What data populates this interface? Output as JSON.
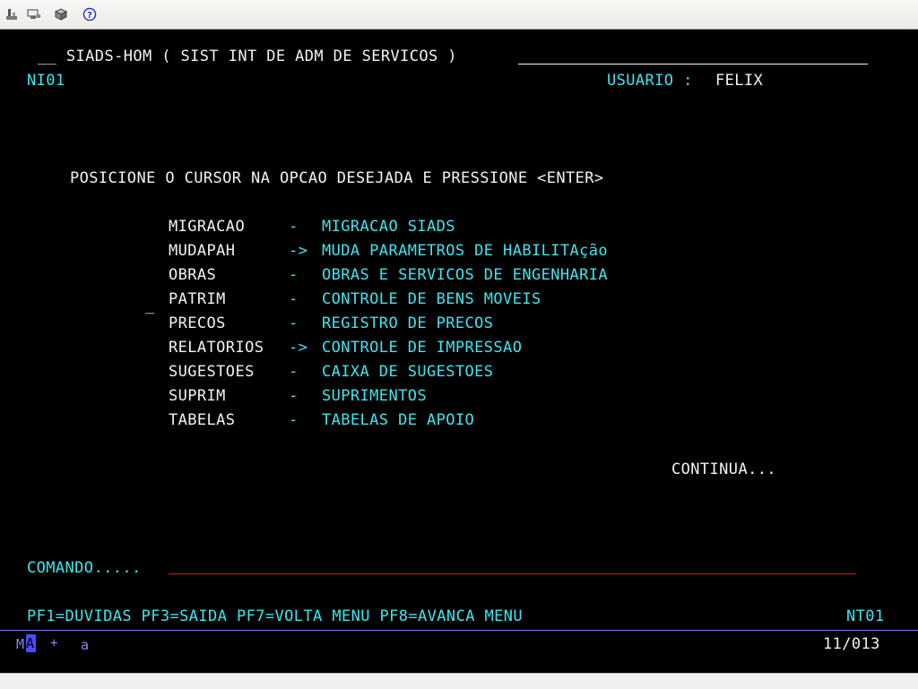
{
  "toolbar": {
    "icons": [
      "print-icon",
      "send-icon",
      "package-icon",
      "help-icon"
    ]
  },
  "header": {
    "title": "__ SIADS-HOM ( SIST INT DE ADM DE SERVICOS )",
    "screen_id": "NI01",
    "user_label": "USUARIO :",
    "user_name": "FELIX"
  },
  "instruction": "POSICIONE O CURSOR NA OPCAO DESEJADA E PRESSIONE <ENTER>",
  "menu": [
    {
      "code": "MIGRACAO",
      "sep": "-",
      "desc": "MIGRACAO SIADS"
    },
    {
      "code": "MUDAPAH",
      "sep": "->",
      "desc": "MUDA PARAMETROS DE HABILITAção"
    },
    {
      "code": "OBRAS",
      "sep": "-",
      "desc": "OBRAS E SERVICOS DE ENGENHARIA"
    },
    {
      "code": "PATRIM",
      "sep": "-",
      "desc": "CONTROLE DE BENS MOVEIS"
    },
    {
      "code": "PRECOS",
      "sep": "-",
      "desc": "REGISTRO DE PRECOS"
    },
    {
      "code": "RELATORIOS",
      "sep": "->",
      "desc": "CONTROLE DE IMPRESSAO"
    },
    {
      "code": "SUGESTOES",
      "sep": "-",
      "desc": "CAIXA DE SUGESTOES"
    },
    {
      "code": "SUPRIM",
      "sep": "-",
      "desc": "SUPRIMENTOS"
    },
    {
      "code": "TABELAS",
      "sep": "-",
      "desc": "TABELAS DE APOIO"
    }
  ],
  "cursor_marker": "_",
  "continua": "CONTINUA...",
  "command": {
    "label": "COMANDO.....",
    "value": ""
  },
  "function_keys": "PF1=DUVIDAS PF3=SAIDA PF7=VOLTA MENU PF8=AVANCA MENU",
  "screen_code": "NT01",
  "status": {
    "session_prefix": "M",
    "session_cursor": "A",
    "indicator": "+",
    "mode": "a",
    "position": "11/013"
  },
  "colors": {
    "background": "#000000",
    "white_text": "#f2f2f2",
    "cyan_text": "#3fe5ef",
    "command_underline": "#cc2020",
    "status_line": "#7f7fff",
    "status_cursor": "#4a4aff"
  }
}
